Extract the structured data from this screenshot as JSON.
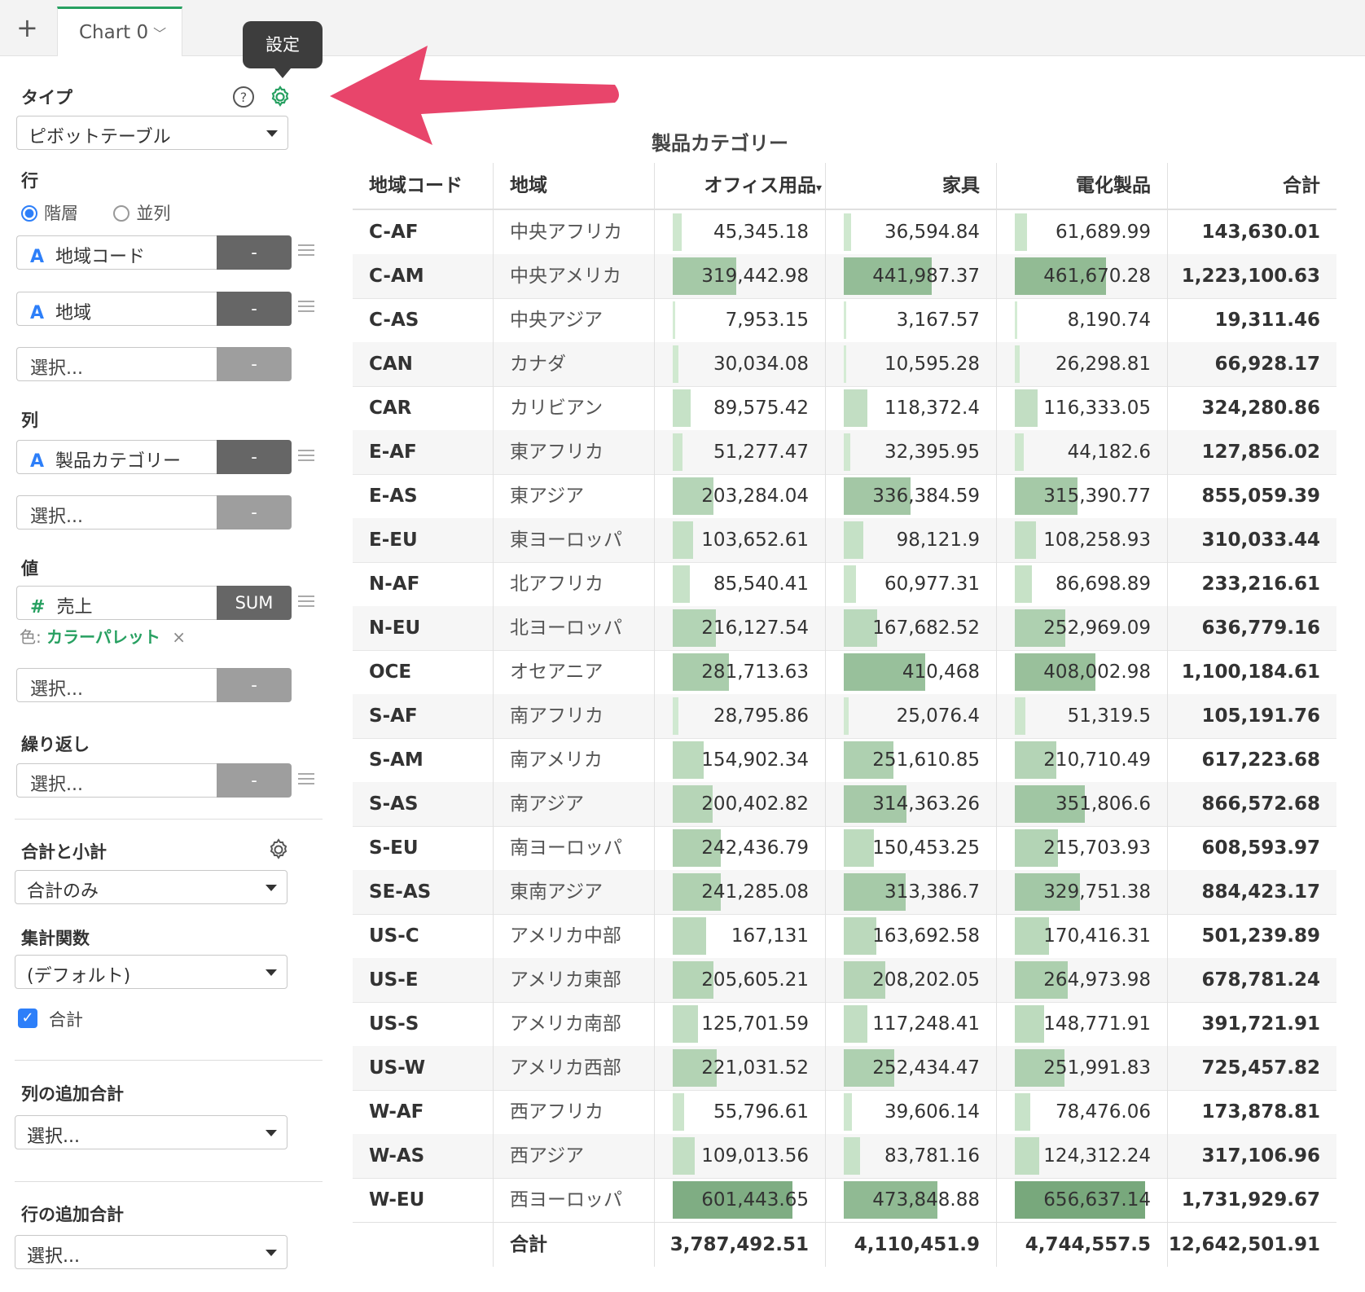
{
  "tabbar": {
    "add_icon": "plus-icon",
    "plus": "+",
    "tab_label": "Chart 0",
    "tab_icon": "chevron-down-icon",
    "chevron": "﹀"
  },
  "tooltip": {
    "text": "設定"
  },
  "sidebar": {
    "type_label": "タイプ",
    "help_icon": "help-circle-icon",
    "help_glyph": "?",
    "settings_icon": "gear-icon",
    "type_value": "ピボットテーブル",
    "rows_label": "行",
    "radio_hier": "階層",
    "radio_parallel": "並列",
    "rows": [
      {
        "type": "A",
        "name": "地域コード",
        "agg": "-"
      },
      {
        "type": "A",
        "name": "地域",
        "agg": "-"
      }
    ],
    "select_placeholder": "選択...",
    "cols_label": "列",
    "cols": [
      {
        "type": "A",
        "name": "製品カテゴリー",
        "agg": "-"
      }
    ],
    "values_label": "値",
    "values": [
      {
        "type": "#",
        "name": "売上",
        "agg": "SUM"
      }
    ],
    "color_prefix": "色:",
    "color_value": "カラーパレット",
    "color_remove": "×",
    "repeat_label": "繰り返し",
    "totals_label": "合計と小計",
    "totals_value": "合計のみ",
    "agg_label": "集計関数",
    "agg_value": "(デフォルト)",
    "total_checkbox_label": "合計",
    "checkmark": "✓",
    "extra_col_total_label": "列の追加合計",
    "extra_row_total_label": "行の追加合計",
    "dash": "-",
    "colors": {
      "accent": "#27a061",
      "blue": "#2d7ff9",
      "pink_arrow": "#e8456b"
    }
  },
  "pivot": {
    "column_title": "製品カテゴリー",
    "headers": [
      "地域コード",
      "地域",
      "オフィス用品",
      "家具",
      "電化製品",
      "合計"
    ],
    "sort_glyph": "▾",
    "max_value": 656637.14,
    "rows": [
      {
        "code": "C-AF",
        "region": "中央アフリカ",
        "office": "45,345.18",
        "office_v": 45345.18,
        "furniture": "36,594.84",
        "furniture_v": 36594.84,
        "tech": "61,689.99",
        "tech_v": 61689.99,
        "total": "143,630.01"
      },
      {
        "code": "C-AM",
        "region": "中央アメリカ",
        "office": "319,442.98",
        "office_v": 319442.98,
        "furniture": "441,987.37",
        "furniture_v": 441987.37,
        "tech": "461,670.28",
        "tech_v": 461670.28,
        "total": "1,223,100.63"
      },
      {
        "code": "C-AS",
        "region": "中央アジア",
        "office": "7,953.15",
        "office_v": 7953.15,
        "furniture": "3,167.57",
        "furniture_v": 3167.57,
        "tech": "8,190.74",
        "tech_v": 8190.74,
        "total": "19,311.46"
      },
      {
        "code": "CAN",
        "region": "カナダ",
        "office": "30,034.08",
        "office_v": 30034.08,
        "furniture": "10,595.28",
        "furniture_v": 10595.28,
        "tech": "26,298.81",
        "tech_v": 26298.81,
        "total": "66,928.17"
      },
      {
        "code": "CAR",
        "region": "カリビアン",
        "office": "89,575.42",
        "office_v": 89575.42,
        "furniture": "118,372.4",
        "furniture_v": 118372.4,
        "tech": "116,333.05",
        "tech_v": 116333.05,
        "total": "324,280.86"
      },
      {
        "code": "E-AF",
        "region": "東アフリカ",
        "office": "51,277.47",
        "office_v": 51277.47,
        "furniture": "32,395.95",
        "furniture_v": 32395.95,
        "tech": "44,182.6",
        "tech_v": 44182.6,
        "total": "127,856.02"
      },
      {
        "code": "E-AS",
        "region": "東アジア",
        "office": "203,284.04",
        "office_v": 203284.04,
        "furniture": "336,384.59",
        "furniture_v": 336384.59,
        "tech": "315,390.77",
        "tech_v": 315390.77,
        "total": "855,059.39"
      },
      {
        "code": "E-EU",
        "region": "東ヨーロッパ",
        "office": "103,652.61",
        "office_v": 103652.61,
        "furniture": "98,121.9",
        "furniture_v": 98121.9,
        "tech": "108,258.93",
        "tech_v": 108258.93,
        "total": "310,033.44"
      },
      {
        "code": "N-AF",
        "region": "北アフリカ",
        "office": "85,540.41",
        "office_v": 85540.41,
        "furniture": "60,977.31",
        "furniture_v": 60977.31,
        "tech": "86,698.89",
        "tech_v": 86698.89,
        "total": "233,216.61"
      },
      {
        "code": "N-EU",
        "region": "北ヨーロッパ",
        "office": "216,127.54",
        "office_v": 216127.54,
        "furniture": "167,682.52",
        "furniture_v": 167682.52,
        "tech": "252,969.09",
        "tech_v": 252969.09,
        "total": "636,779.16"
      },
      {
        "code": "OCE",
        "region": "オセアニア",
        "office": "281,713.63",
        "office_v": 281713.63,
        "furniture": "410,468",
        "furniture_v": 410468,
        "tech": "408,002.98",
        "tech_v": 408002.98,
        "total": "1,100,184.61"
      },
      {
        "code": "S-AF",
        "region": "南アフリカ",
        "office": "28,795.86",
        "office_v": 28795.86,
        "furniture": "25,076.4",
        "furniture_v": 25076.4,
        "tech": "51,319.5",
        "tech_v": 51319.5,
        "total": "105,191.76"
      },
      {
        "code": "S-AM",
        "region": "南アメリカ",
        "office": "154,902.34",
        "office_v": 154902.34,
        "furniture": "251,610.85",
        "furniture_v": 251610.85,
        "tech": "210,710.49",
        "tech_v": 210710.49,
        "total": "617,223.68"
      },
      {
        "code": "S-AS",
        "region": "南アジア",
        "office": "200,402.82",
        "office_v": 200402.82,
        "furniture": "314,363.26",
        "furniture_v": 314363.26,
        "tech": "351,806.6",
        "tech_v": 351806.6,
        "total": "866,572.68"
      },
      {
        "code": "S-EU",
        "region": "南ヨーロッパ",
        "office": "242,436.79",
        "office_v": 242436.79,
        "furniture": "150,453.25",
        "furniture_v": 150453.25,
        "tech": "215,703.93",
        "tech_v": 215703.93,
        "total": "608,593.97"
      },
      {
        "code": "SE-AS",
        "region": "東南アジア",
        "office": "241,285.08",
        "office_v": 241285.08,
        "furniture": "313,386.7",
        "furniture_v": 313386.7,
        "tech": "329,751.38",
        "tech_v": 329751.38,
        "total": "884,423.17"
      },
      {
        "code": "US-C",
        "region": "アメリカ中部",
        "office": "167,131",
        "office_v": 167131,
        "furniture": "163,692.58",
        "furniture_v": 163692.58,
        "tech": "170,416.31",
        "tech_v": 170416.31,
        "total": "501,239.89"
      },
      {
        "code": "US-E",
        "region": "アメリカ東部",
        "office": "205,605.21",
        "office_v": 205605.21,
        "furniture": "208,202.05",
        "furniture_v": 208202.05,
        "tech": "264,973.98",
        "tech_v": 264973.98,
        "total": "678,781.24"
      },
      {
        "code": "US-S",
        "region": "アメリカ南部",
        "office": "125,701.59",
        "office_v": 125701.59,
        "furniture": "117,248.41",
        "furniture_v": 117248.41,
        "tech": "148,771.91",
        "tech_v": 148771.91,
        "total": "391,721.91"
      },
      {
        "code": "US-W",
        "region": "アメリカ西部",
        "office": "221,031.52",
        "office_v": 221031.52,
        "furniture": "252,434.47",
        "furniture_v": 252434.47,
        "tech": "251,991.83",
        "tech_v": 251991.83,
        "total": "725,457.82"
      },
      {
        "code": "W-AF",
        "region": "西アフリカ",
        "office": "55,796.61",
        "office_v": 55796.61,
        "furniture": "39,606.14",
        "furniture_v": 39606.14,
        "tech": "78,476.06",
        "tech_v": 78476.06,
        "total": "173,878.81"
      },
      {
        "code": "W-AS",
        "region": "西アジア",
        "office": "109,013.56",
        "office_v": 109013.56,
        "furniture": "83,781.16",
        "furniture_v": 83781.16,
        "tech": "124,312.24",
        "tech_v": 124312.24,
        "total": "317,106.96"
      },
      {
        "code": "W-EU",
        "region": "西ヨーロッパ",
        "office": "601,443.65",
        "office_v": 601443.65,
        "furniture": "473,848.88",
        "furniture_v": 473848.88,
        "tech": "656,637.14",
        "tech_v": 656637.14,
        "total": "1,731,929.67"
      }
    ],
    "grand_total": {
      "label": "合計",
      "office": "3,787,492.51",
      "furniture": "4,110,451.9",
      "tech": "4,744,557.5",
      "total": "12,642,501.91"
    }
  }
}
